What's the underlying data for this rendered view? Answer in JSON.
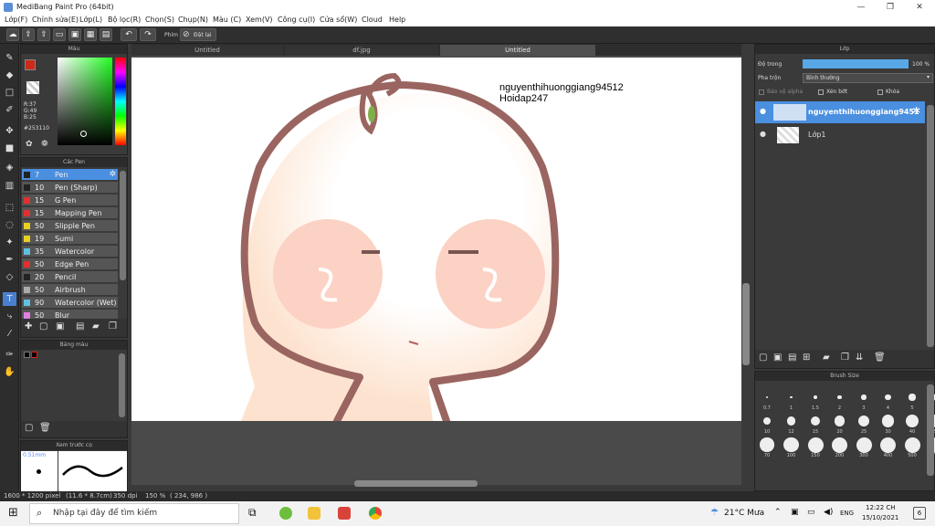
{
  "window": {
    "title": "MediBang Paint Pro (64bit)",
    "min": "—",
    "max": "❐",
    "close": "✕"
  },
  "menu": [
    "Lớp(F)",
    "Chỉnh sửa(E)",
    "Lớp(L)",
    "Bộ lọc(R)",
    "Chọn(S)",
    "Chụp(N)",
    "Màu (C)",
    "Xem(V)",
    "Công cụ(I)",
    "Cửa sổ(W)",
    "Cloud",
    "Help"
  ],
  "toolbar": {
    "snap_label": "Phím",
    "reset_label": "Đặt lại"
  },
  "color_panel": {
    "title": "Màu",
    "r": "R:37",
    "g": "G:49",
    "b": "B:25",
    "hex": "#253110",
    "fg": "#cc2a1a",
    "bg": "#ffffff"
  },
  "pen_panel": {
    "title": "Các Pen",
    "items": [
      {
        "size": "7",
        "name": "Pen",
        "color": "#222222",
        "selected": true
      },
      {
        "size": "10",
        "name": "Pen (Sharp)",
        "color": "#222222"
      },
      {
        "size": "15",
        "name": "G Pen",
        "color": "#e03030"
      },
      {
        "size": "15",
        "name": "Mapping Pen",
        "color": "#e03030"
      },
      {
        "size": "50",
        "name": "Slipple Pen",
        "color": "#e8d020"
      },
      {
        "size": "19",
        "name": "Sumi",
        "color": "#e8d020"
      },
      {
        "size": "35",
        "name": "Watercolor",
        "color": "#60c0e0"
      },
      {
        "size": "50",
        "name": "Edge Pen",
        "color": "#e03030"
      },
      {
        "size": "20",
        "name": "Pencil",
        "color": "#222222"
      },
      {
        "size": "50",
        "name": "Airbrush",
        "color": "#aaaaaa"
      },
      {
        "size": "90",
        "name": "Watercolor (Wet)",
        "color": "#60c0e0"
      },
      {
        "size": "50",
        "name": "Blur",
        "color": "#e080e0"
      }
    ]
  },
  "palette_panel": {
    "title": "Bảng màu"
  },
  "preview_panel": {
    "title": "Xem trước cọ",
    "size": "0.51mm"
  },
  "tabs": [
    "Untitled",
    "df.jpg",
    "Untitled"
  ],
  "canvas": {
    "text1": "nguyenthihuonggiang94512",
    "text2": "Hoidap247"
  },
  "layer_panel": {
    "title": "Lớp",
    "opacity_label": "Độ trong",
    "opacity_value": "100 %",
    "blend_label": "Pha trộn",
    "blend_value": "Bình thường",
    "protect_alpha": "Bảo vệ alpha",
    "clip": "Xén bớt",
    "lock": "Khóa",
    "layers": [
      {
        "name": "nguyenthihuonggiang9451",
        "selected": true
      },
      {
        "name": "Lớp1",
        "selected": false
      }
    ]
  },
  "brush_panel": {
    "title": "Brush Size",
    "sizes": [
      "0.7",
      "1",
      "1.5",
      "2",
      "3",
      "4",
      "5",
      "7",
      "10",
      "12",
      "15",
      "20",
      "25",
      "30",
      "40",
      "50",
      "70",
      "100",
      "150",
      "200",
      "300",
      "400",
      "500",
      "700"
    ]
  },
  "status": {
    "dimensions": "1600 * 1200 pixel",
    "cm": "(11.6 * 8.7cm)",
    "dpi": "350 dpi",
    "zoom": "150 %",
    "coords": "( 234, 986 )"
  },
  "taskbar": {
    "search_placeholder": "Nhập tại đây để tìm kiếm",
    "weather": "21°C  Mưa",
    "lang": "ENG",
    "time": "12:22 CH",
    "date": "15/10/2021",
    "notif": "6"
  }
}
